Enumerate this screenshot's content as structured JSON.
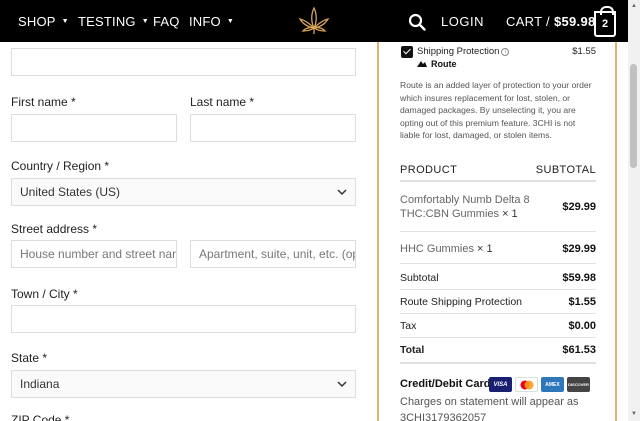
{
  "header": {
    "nav": [
      {
        "label": "SHOP",
        "has_caret": true
      },
      {
        "label": "TESTING",
        "has_caret": true
      },
      {
        "label": "FAQ",
        "has_caret": false
      },
      {
        "label": "INFO",
        "has_caret": true
      }
    ],
    "logo_icon": "cannabis-leaf-logo",
    "search_icon": "search-icon",
    "login_label": "LOGIN",
    "cart_label": "CART /",
    "cart_total": "$59.98",
    "cart_count": "2",
    "background": "#000000",
    "logo_color": "#d8a45a"
  },
  "form": {
    "first_name_label": "First name *",
    "last_name_label": "Last name *",
    "country_label": "Country / Region *",
    "country_value": "United States (US)",
    "street_label": "Street address *",
    "street_placeholder": "House number and street name",
    "apartment_placeholder": "Apartment, suite, unit, etc. (optional)",
    "city_label": "Town / City *",
    "state_label": "State *",
    "state_value": "Indiana",
    "zip_label": "ZIP Code *"
  },
  "order": {
    "accent_border": "#e0b36a",
    "route": {
      "checked": true,
      "label": "Shipping Protection",
      "price": "$1.55",
      "brand": "Route",
      "description": "Route is an added layer of protection to your order which insures replacement for lost, stolen, or damaged packages. By unselecting it, you are opting out of this premium feature. 3CHI is not liable for lost, damaged, or stolen items."
    },
    "table_headers": {
      "product": "PRODUCT",
      "subtotal": "SUBTOTAL"
    },
    "items": [
      {
        "name": "Comfortably Numb Delta 8 THC:CBN Gummies",
        "qty": "× 1",
        "price": "$29.99"
      },
      {
        "name": "HHC Gummies",
        "qty": "× 1",
        "price": "$29.99"
      }
    ],
    "summary": [
      {
        "label": "Subtotal",
        "value": "$59.98"
      },
      {
        "label": "Route Shipping Protection",
        "value": "$1.55"
      },
      {
        "label": "Tax",
        "value": "$0.00"
      },
      {
        "label": "Total",
        "value": "$61.53"
      }
    ],
    "payment": {
      "title": "Credit/Debit Card",
      "cards": [
        "VISA",
        "mastercard",
        "AMEX",
        "DISCOVER"
      ],
      "note": "Charges on statement will appear as 3CHI3179362057"
    }
  }
}
